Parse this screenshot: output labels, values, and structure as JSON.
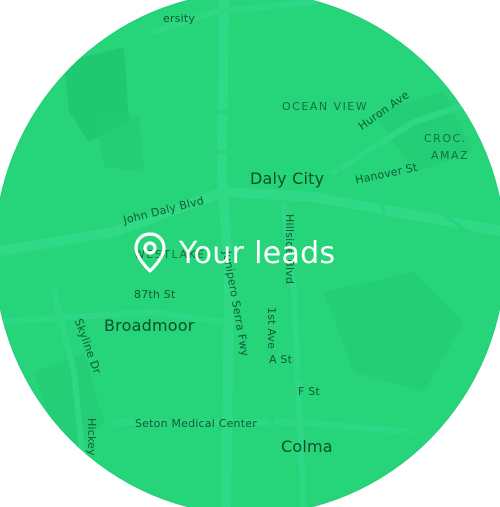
{
  "overlay": {
    "headline": "Your leads",
    "icon": "map-pin-icon"
  },
  "colors": {
    "map_fill": "#26d47a",
    "text_overlay": "#ffffff",
    "label_text": "#0e5a31"
  },
  "map_labels": {
    "university": "ersity",
    "ocean_view": "OCEAN VIEW",
    "huron_ave": "Huron Ave",
    "croc": "CROC.",
    "amaz": "AMAZ",
    "hanover_st": "Hanover St",
    "daly_city": "Daly City",
    "john_daly_blvd": "John Daly Blvd",
    "westlake": "WESTLAKE",
    "hillside_blvd": "Hillside Blvd",
    "st_87th": "87th St",
    "serra_fwy": "Junipero Serra Fwy",
    "broadmoor": "Broadmoor",
    "first_ave": "1st Ave",
    "a_st": "A St",
    "skyline_dr": "Skyline Dr",
    "f_st": "F St",
    "hickey": "Hickey",
    "seton": "Seton Medical Center",
    "colma": "Colma"
  }
}
